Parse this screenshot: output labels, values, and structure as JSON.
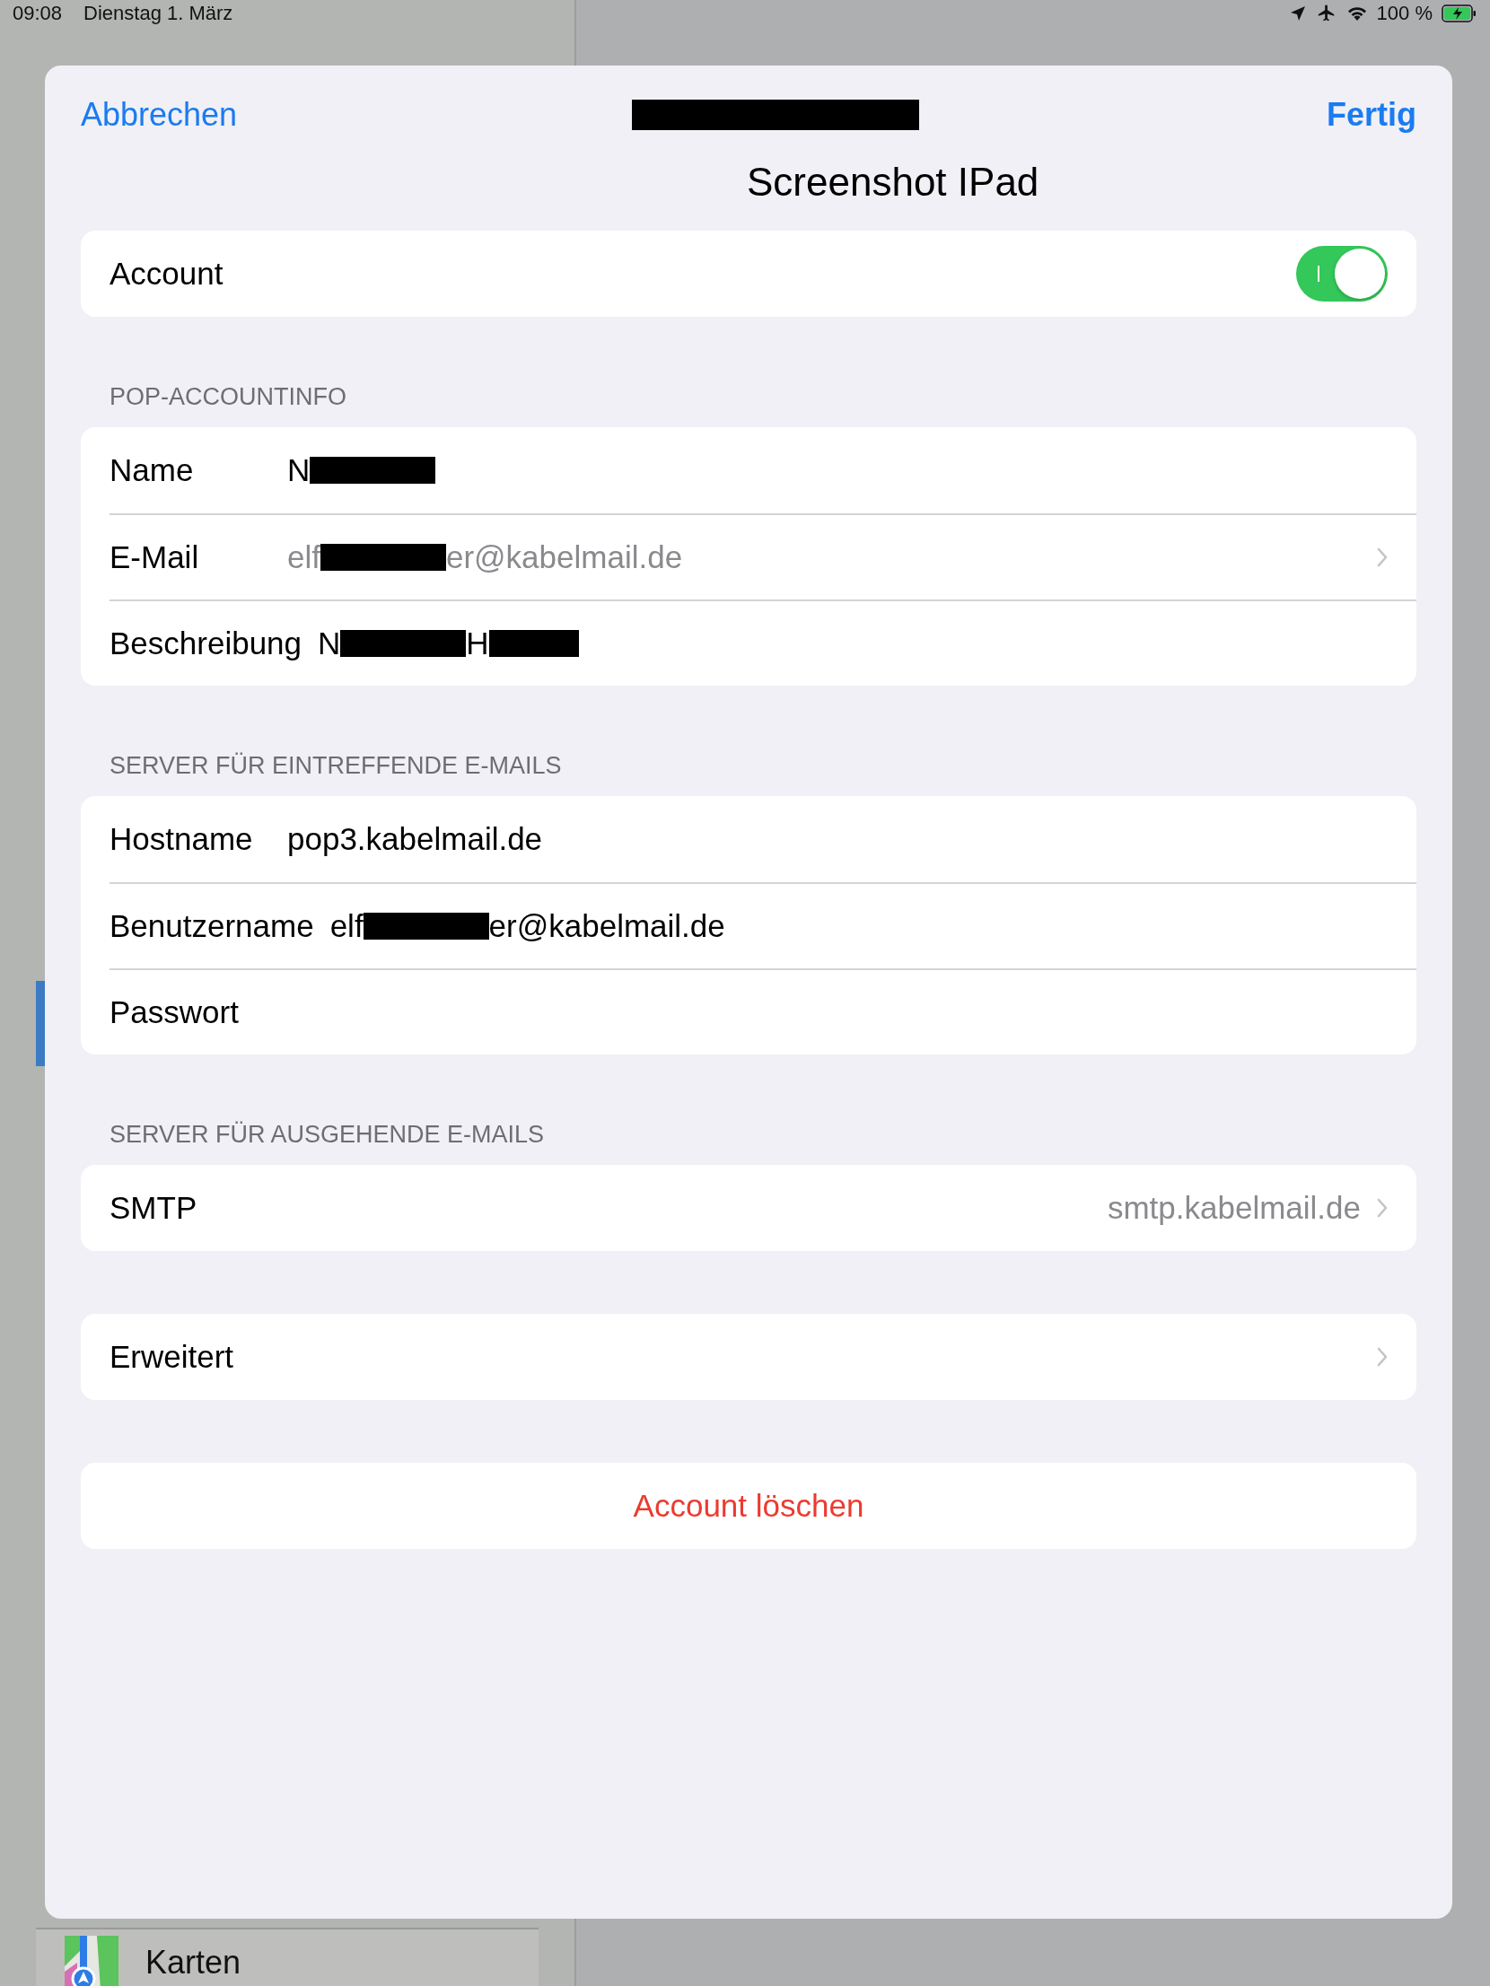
{
  "status_bar": {
    "time": "09:08",
    "date": "Dienstag 1. März",
    "battery": "100 %"
  },
  "background": {
    "sidebar_item": "Karten"
  },
  "sheet": {
    "cancel": "Abbrechen",
    "done": "Fertig",
    "subtitle": "Screenshot IPad",
    "account_toggle": {
      "label": "Account",
      "on": true
    },
    "sections": [
      {
        "header": "POP-ACCOUNTINFO",
        "rows": [
          {
            "label": "Name",
            "value_start": "N",
            "dimmed": false,
            "chevron": false
          },
          {
            "label": "E-Mail",
            "value_start": "elf",
            "value_end": "er@kabelmail.de",
            "dimmed": true,
            "chevron": true
          },
          {
            "label": "Beschreibung",
            "value_start": "N",
            "value_middle": "H",
            "dimmed": false,
            "chevron": false
          }
        ]
      },
      {
        "header": "SERVER FÜR EINTREFFENDE E-MAILS",
        "rows": [
          {
            "label": "Hostname",
            "value_start": "pop3.kabelmail.de",
            "dimmed": false,
            "chevron": false
          },
          {
            "label": "Benutzername",
            "value_start": "elf",
            "value_end": "er@kabelmail.de",
            "dimmed": false,
            "chevron": false
          },
          {
            "label": "Passwort",
            "chevron": false
          }
        ]
      },
      {
        "header": "SERVER FÜR AUSGEHENDE E-MAILS",
        "rows": [
          {
            "label": "SMTP",
            "detail": "smtp.kabelmail.de",
            "chevron": true
          }
        ]
      },
      {
        "rows": [
          {
            "label": "Erweitert",
            "chevron": true
          }
        ]
      }
    ],
    "delete": "Account löschen"
  }
}
